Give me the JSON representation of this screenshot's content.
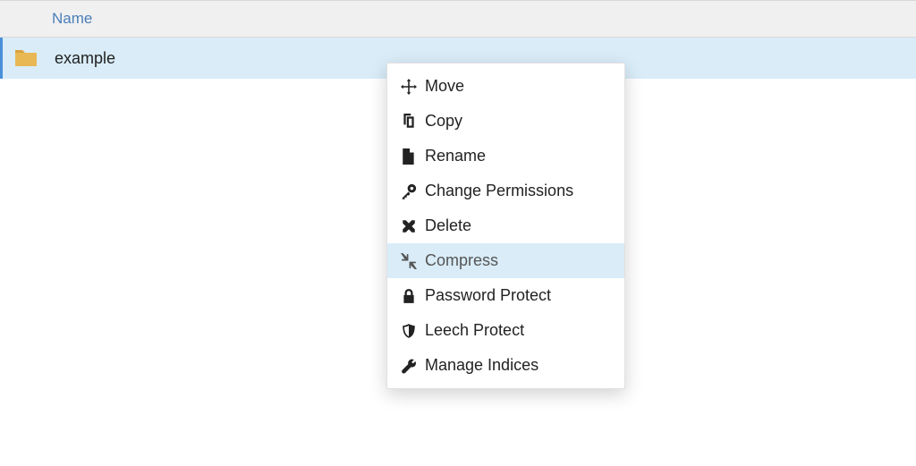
{
  "table": {
    "header": "Name",
    "rows": [
      {
        "name": "example",
        "type": "folder"
      }
    ]
  },
  "contextMenu": {
    "items": [
      {
        "label": "Move",
        "icon": "move-icon"
      },
      {
        "label": "Copy",
        "icon": "copy-icon"
      },
      {
        "label": "Rename",
        "icon": "rename-icon"
      },
      {
        "label": "Change Permissions",
        "icon": "key-icon"
      },
      {
        "label": "Delete",
        "icon": "delete-icon"
      },
      {
        "label": "Compress",
        "icon": "compress-icon",
        "hover": true
      },
      {
        "label": "Password Protect",
        "icon": "lock-icon"
      },
      {
        "label": "Leech Protect",
        "icon": "shield-icon"
      },
      {
        "label": "Manage Indices",
        "icon": "wrench-icon"
      }
    ]
  }
}
